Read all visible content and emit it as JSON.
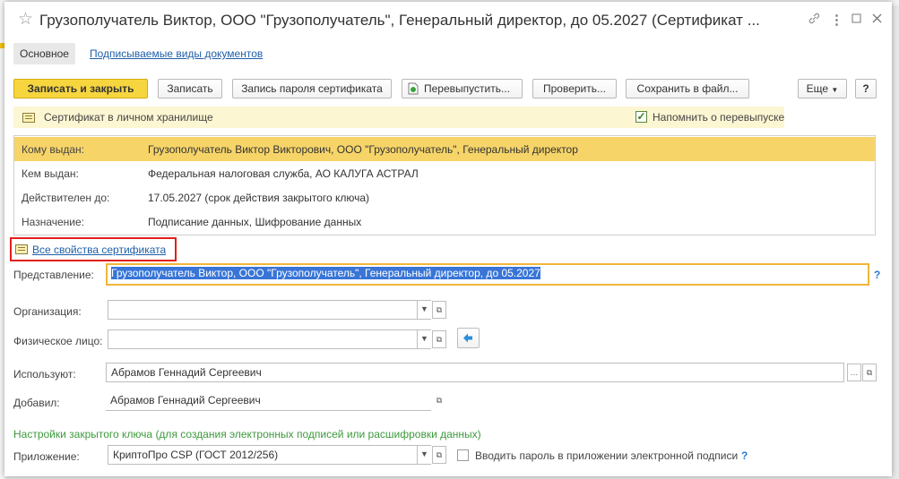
{
  "window": {
    "title": "Грузополучатель Виктор, ООО \"Грузополучатель\", Генеральный директор, до 05.2027 (Сертификат ...",
    "star_icon": "star-icon",
    "link_icon": "link-icon",
    "more_icon": "more-vertical-icon",
    "maximize_icon": "maximize-icon",
    "close_icon": "close-icon"
  },
  "tabs": {
    "main": "Основное",
    "signed_doc_types": "Подписываемые виды документов"
  },
  "toolbar": {
    "save_close": "Записать и закрыть",
    "save": "Записать",
    "save_password": "Запись пароля сертификата",
    "reissue": "Перевыпустить...",
    "check": "Проверить...",
    "save_to_file": "Сохранить в файл...",
    "more": "Еще",
    "help": "?",
    "colors": {
      "primary": "#f7d53e",
      "primary_border": "#d1ad10"
    }
  },
  "info": {
    "storage_text": "Сертификат в личном хранилище",
    "remind_label": "Напомнить о перевыпуске",
    "remind_checked": true
  },
  "details": [
    {
      "label": "Кому выдан:",
      "value": "Грузополучатель Виктор Викторович, ООО \"Грузополучатель\", Генеральный директор",
      "highlighted": true
    },
    {
      "label": "Кем выдан:",
      "value": "Федеральная налоговая служба, АО КАЛУГА АСТРАЛ",
      "highlighted": false
    },
    {
      "label": "Действителен до:",
      "value": "17.05.2027 (срок действия закрытого ключа)",
      "highlighted": false
    },
    {
      "label": "Назначение:",
      "value": "Подписание данных, Шифрование данных",
      "highlighted": false
    }
  ],
  "all_properties_link": "Все свойства сертификата",
  "form": {
    "presentation_label": "Представление:",
    "presentation_value": "Грузополучатель Виктор, ООО \"Грузополучатель\", Генеральный директор, до 05.2027",
    "presentation_help": "?",
    "organization_label": "Организация:",
    "organization_value": "",
    "person_label": "Физическое лицо:",
    "person_value": "",
    "used_by_label": "Используют:",
    "used_by_value": "Абрамов Геннадий Сергеевич",
    "added_by_label": "Добавил:",
    "added_by_value": "Абрамов Геннадий Сергеевич",
    "key_settings_header": "Настройки закрытого ключа (для создания электронных подписей или расшифровки данных)",
    "app_label": "Приложение:",
    "app_value": "КриптоПро CSP (ГОСТ 2012/256)",
    "enter_password_label": "Вводить пароль в приложении электронной подписи",
    "enter_password_checked": false,
    "enter_password_help": "?",
    "colors": {
      "section_header": "#3d9a3d",
      "focus_border": "#f0b63a",
      "help": "#2a7ad0",
      "selection": "#3875d7"
    }
  }
}
